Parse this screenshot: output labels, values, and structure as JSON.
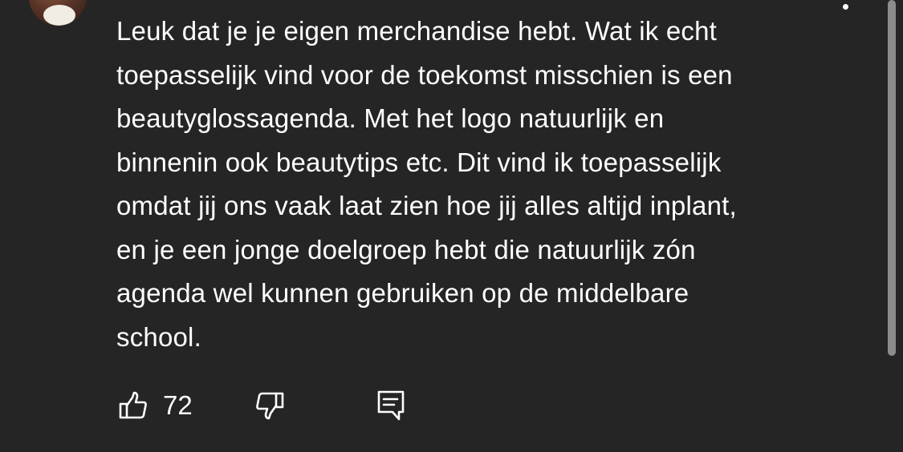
{
  "comment": {
    "text": "Leuk dat je je eigen merchandise hebt. Wat ik echt\ntoepasselijk vind voor de toekomst misschien is een\nbeautyglossagenda. Met het logo natuurlijk en\nbinnenin ook beautytips etc. Dit vind ik toepasselijk\nomdat jij ons vaak laat zien hoe jij alles altijd inplant,\nen je een jonge doelgroep hebt die natuurlijk zón\nagenda wel kunnen gebruiken op de middelbare\nschool.",
    "like_count": "72"
  },
  "icons": {
    "avatar": "avatar",
    "more": "more-options-icon",
    "like": "thumbs-up-icon",
    "dislike": "thumbs-down-icon",
    "reply": "reply-comment-icon"
  },
  "colors": {
    "background": "#252525",
    "text": "#ffffff",
    "scrollbar": "#8c8c8c"
  }
}
